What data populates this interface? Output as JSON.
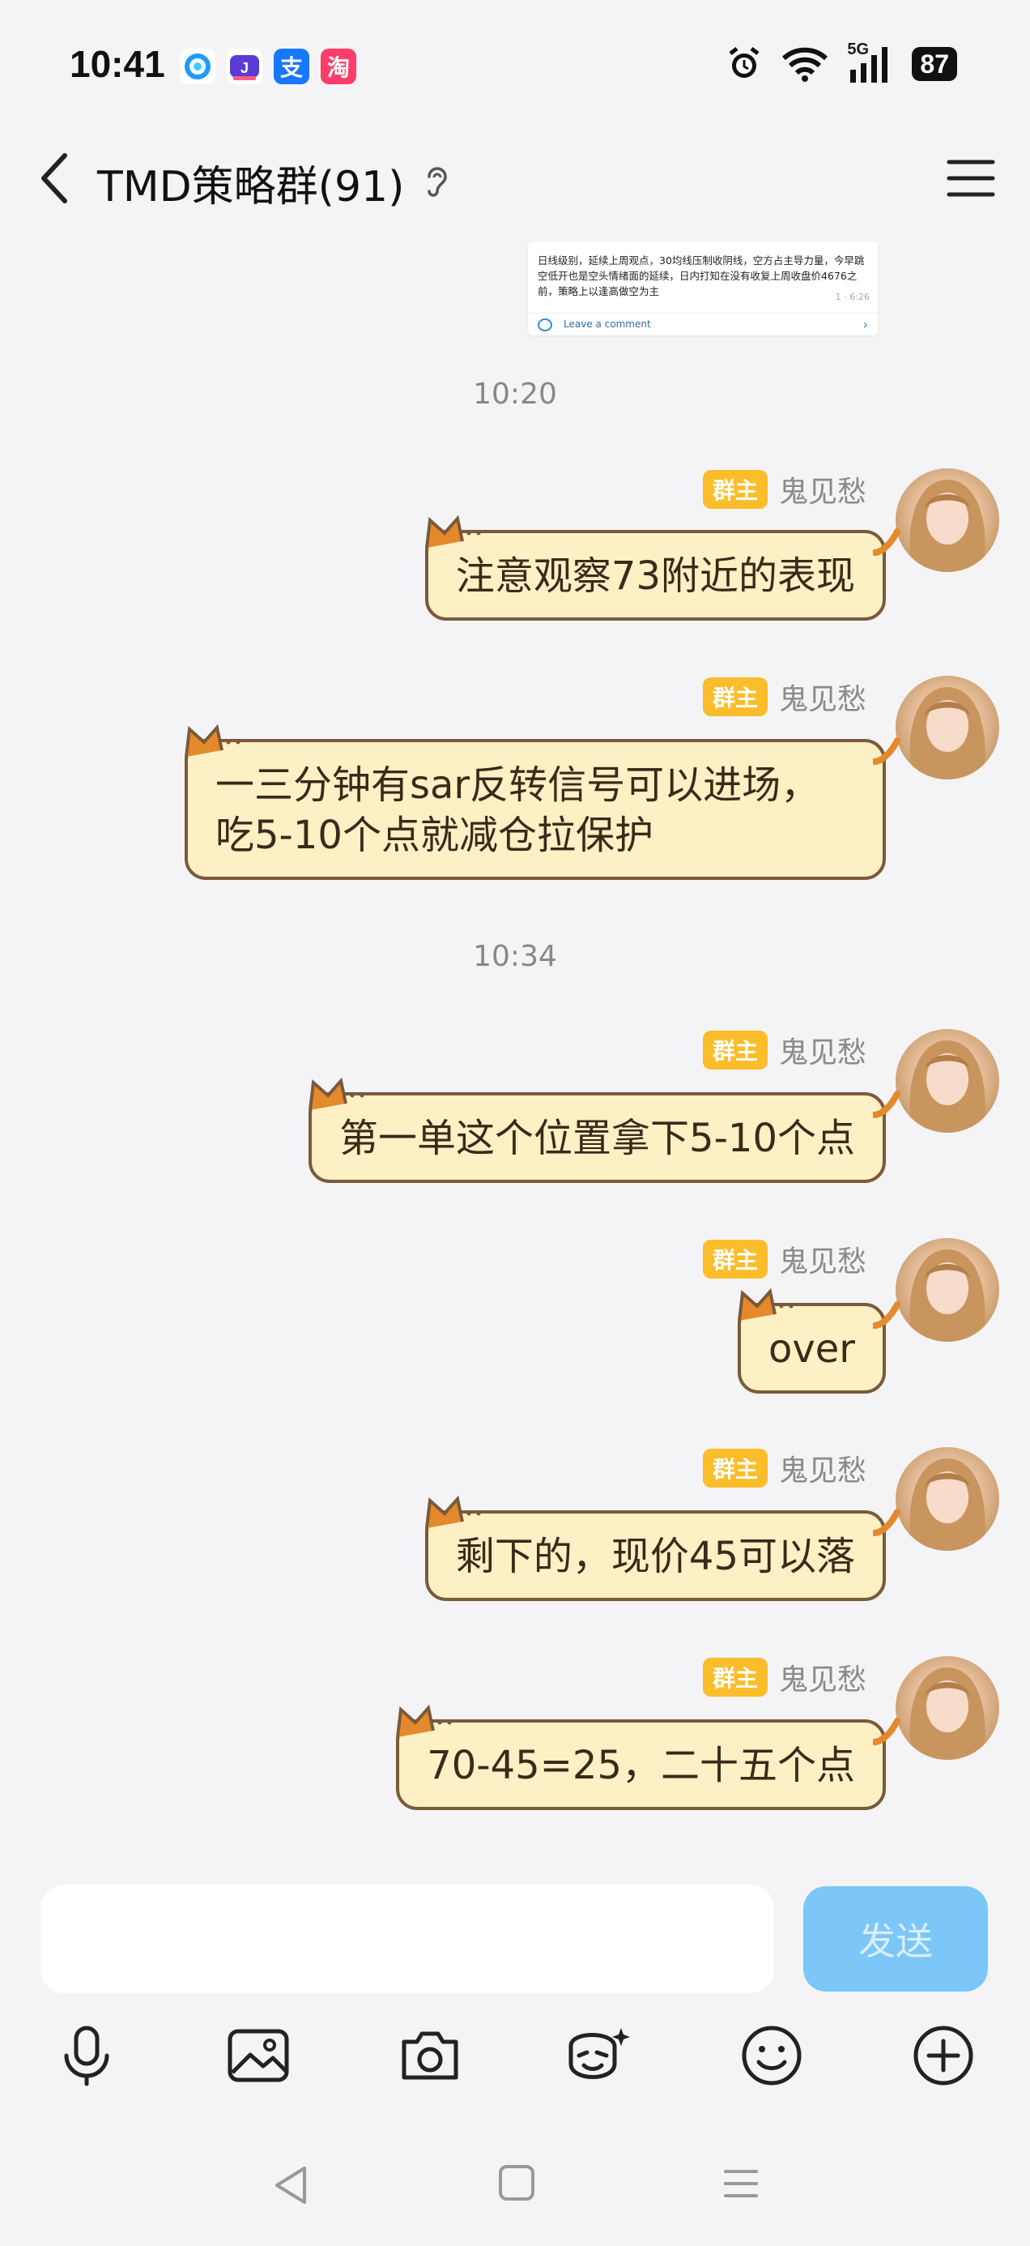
{
  "status_bar": {
    "time": "10:41",
    "network": "5G",
    "battery": "87",
    "notif_icons": [
      "qq-browser-icon",
      "app-icon",
      "alipay-icon",
      "taobao-icon"
    ],
    "alipay_glyph": "支",
    "taobao_glyph": "淘"
  },
  "nav": {
    "title": "TMD策略群(91)"
  },
  "forwarded_card": {
    "body": "日线级别，延续上周观点，30均线压制收阴线，空方占主导力量，今早跳空低开也是空头情绪面的延续，日内打知在没有收复上周收盘价4676之前，策略上以逢高做空为主",
    "meta": "1 · 6:26",
    "comment": "Leave a comment"
  },
  "timestamps": [
    "10:20",
    "10:34"
  ],
  "sender": {
    "role": "群主",
    "name": "鬼见愁"
  },
  "messages": [
    {
      "text": "注意观察73附近的表现"
    },
    {
      "text": "一三分钟有sar反转信号可以进场，吃5-10个点就减仓拉保护"
    },
    {
      "text": "第一单这个位置拿下5-10个点"
    },
    {
      "text": "over"
    },
    {
      "text": "剩下的，现价45可以落"
    },
    {
      "text": "70-45=25，二十五个点"
    }
  ],
  "input": {
    "placeholder": "",
    "send_label": "发送"
  },
  "toolbar": [
    "microphone-icon",
    "image-icon",
    "camera-icon",
    "sticker-icon",
    "emoji-icon",
    "plus-icon"
  ],
  "colors": {
    "background": "#f4f4f6",
    "bubble_fill": "#fdf0c4",
    "bubble_border": "#7b5a3a",
    "badge": "#fbbd2a",
    "send_button": "#7cc7f7"
  }
}
